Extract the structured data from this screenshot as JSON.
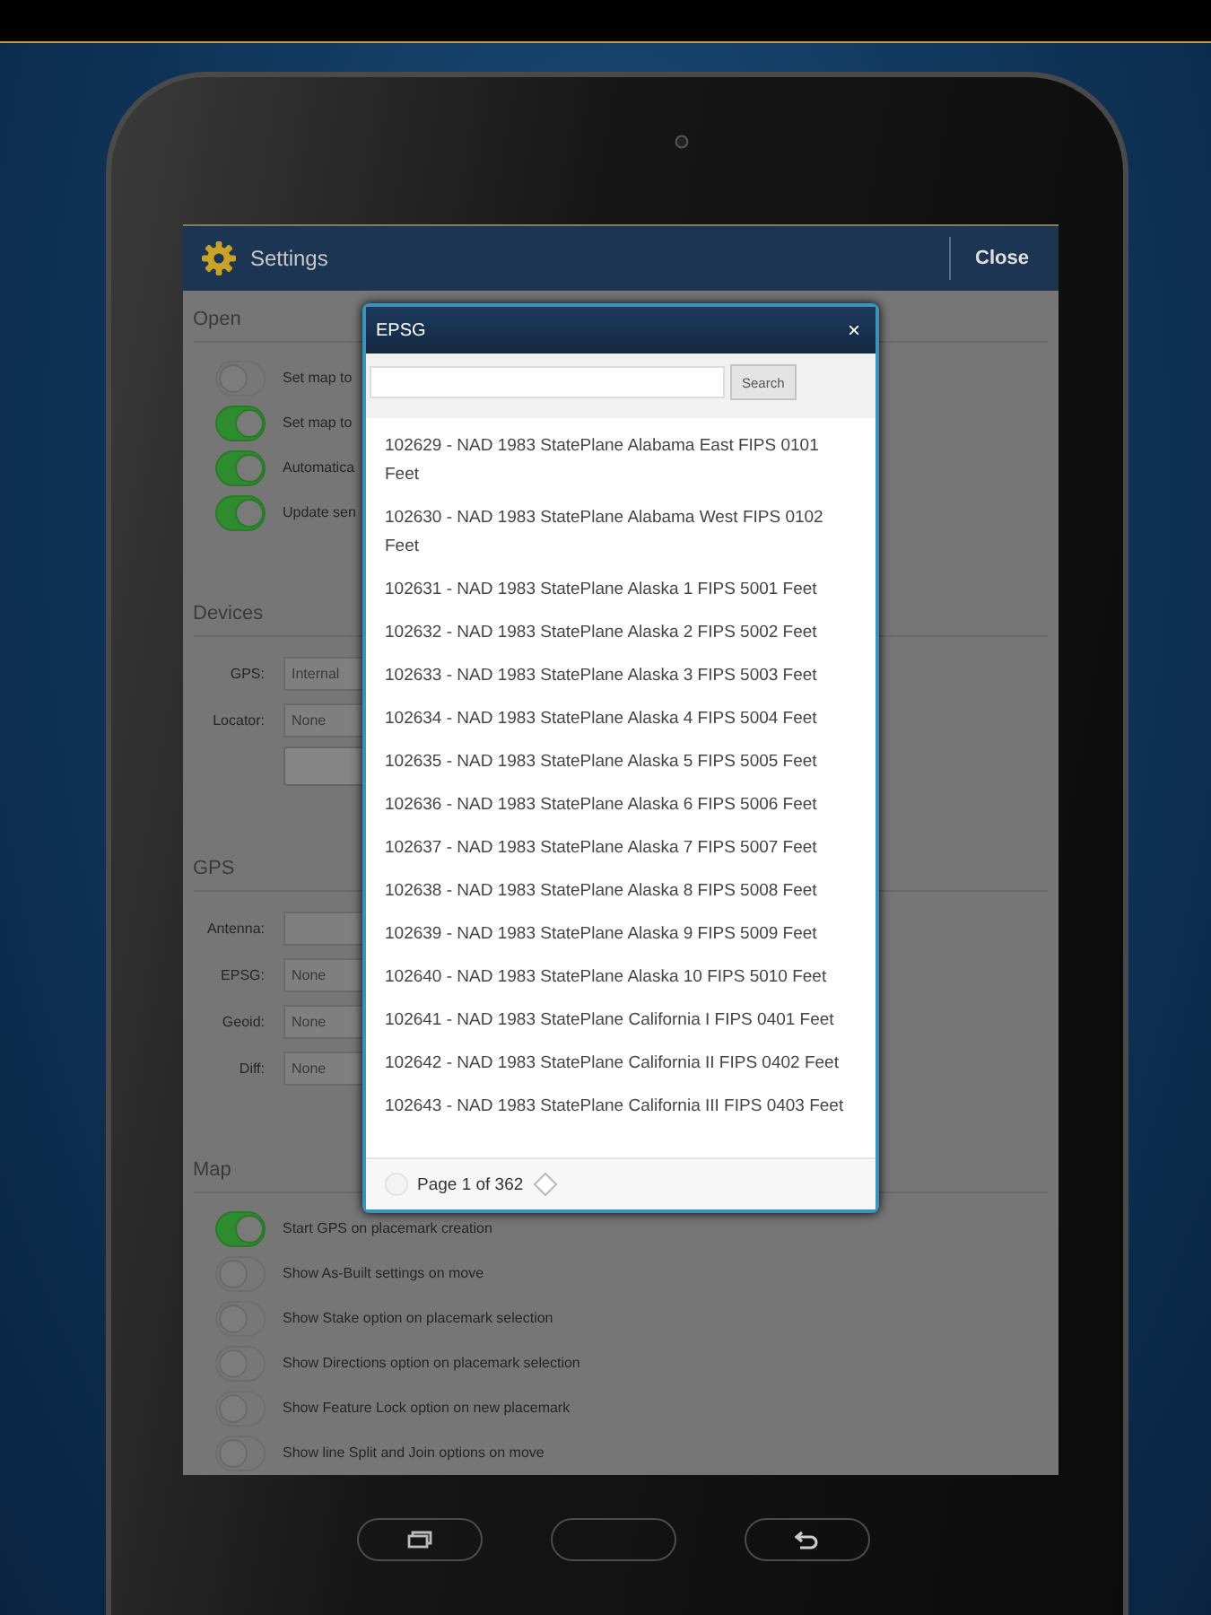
{
  "app_bar": {
    "title": "Settings",
    "close": "Close"
  },
  "sections": [
    {
      "title": "Open",
      "rows": [
        {
          "kind": "toggle",
          "on": false,
          "label": "Set map to"
        },
        {
          "kind": "toggle",
          "on": true,
          "label": "Set map to"
        },
        {
          "kind": "toggle",
          "on": true,
          "label": "Automatica"
        },
        {
          "kind": "toggle",
          "on": true,
          "label": "Update sen"
        }
      ]
    },
    {
      "title": "Devices",
      "rows": [
        {
          "kind": "select",
          "label": "GPS:",
          "value": "Internal"
        },
        {
          "kind": "select",
          "label": "Locator:",
          "value": "None"
        },
        {
          "kind": "button"
        }
      ]
    },
    {
      "title": "GPS",
      "rows": [
        {
          "kind": "field",
          "label": "Antenna:"
        },
        {
          "kind": "select",
          "label": "EPSG:",
          "value": "None"
        },
        {
          "kind": "select",
          "label": "Geoid:",
          "value": "None"
        },
        {
          "kind": "select",
          "label": "Diff:",
          "value": "None"
        }
      ]
    },
    {
      "title": "Map",
      "rows": [
        {
          "kind": "toggle",
          "on": true,
          "label": "Start GPS on placemark creation"
        },
        {
          "kind": "toggle",
          "on": false,
          "label": "Show As-Built settings on move"
        },
        {
          "kind": "toggle",
          "on": false,
          "label": "Show Stake option on placemark selection"
        },
        {
          "kind": "toggle",
          "on": false,
          "label": "Show Directions option on placemark selection"
        },
        {
          "kind": "toggle",
          "on": false,
          "label": "Show Feature Lock option on new placemark"
        },
        {
          "kind": "toggle",
          "on": false,
          "label": "Show line Split and Join options on move"
        }
      ]
    }
  ],
  "dialog": {
    "title": "EPSG",
    "close": "×",
    "search_button": "Search",
    "items": [
      "102629 - NAD 1983 StatePlane Alabama East FIPS 0101 Feet",
      "102630 - NAD 1983 StatePlane Alabama West FIPS 0102 Feet",
      "102631 - NAD 1983 StatePlane Alaska 1 FIPS 5001 Feet",
      "102632 - NAD 1983 StatePlane Alaska 2 FIPS 5002 Feet",
      "102633 - NAD 1983 StatePlane Alaska 3 FIPS 5003 Feet",
      "102634 - NAD 1983 StatePlane Alaska 4 FIPS 5004 Feet",
      "102635 - NAD 1983 StatePlane Alaska 5 FIPS 5005 Feet",
      "102636 - NAD 1983 StatePlane Alaska 6 FIPS 5006 Feet",
      "102637 - NAD 1983 StatePlane Alaska 7 FIPS 5007 Feet",
      "102638 - NAD 1983 StatePlane Alaska 8 FIPS 5008 Feet",
      "102639 - NAD 1983 StatePlane Alaska 9 FIPS 5009 Feet",
      "102640 - NAD 1983 StatePlane Alaska 10 FIPS 5010 Feet",
      "102641 - NAD 1983 StatePlane California I FIPS 0401 Feet",
      "102642 - NAD 1983 StatePlane California II FIPS 0402 Feet",
      "102643 - NAD 1983 StatePlane California III FIPS 0403 Feet"
    ],
    "pager": "Page 1 of 362"
  }
}
